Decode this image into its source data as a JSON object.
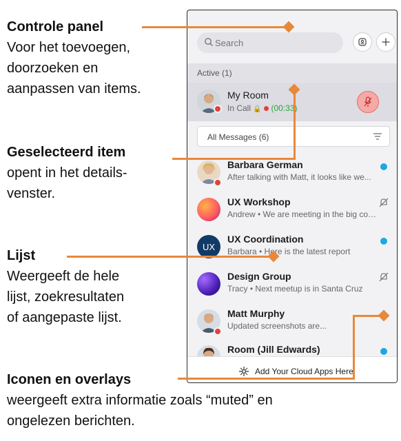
{
  "annotations": {
    "control_panel": {
      "title": "Controle panel",
      "lines": [
        "Voor het toevoegen,",
        "doorzoeken en",
        "aanpassen van items."
      ]
    },
    "selected_item": {
      "title": "Geselecteerd item",
      "lines": [
        "opent in het details-",
        "venster."
      ]
    },
    "list": {
      "title": "Lijst",
      "lines": [
        "Weergeeft de hele",
        "lijst, zoekresultaten",
        "of aangepaste lijst."
      ]
    },
    "icons_overlays": {
      "title": "Iconen en overlays",
      "lines": [
        "weergeeft extra informatie zoals “muted” en",
        "ongelezen berichten."
      ]
    }
  },
  "accent_color": "#e8883a",
  "app": {
    "search": {
      "placeholder": "Search"
    },
    "active_header": "Active (1)",
    "active_item": {
      "name": "My Room",
      "status": "In Call",
      "timer": "(00:33)"
    },
    "filter": {
      "label": "All Messages (6)"
    },
    "items": [
      {
        "title": "Barbara German",
        "message": "After talking with Matt, it looks like we...",
        "unread": true,
        "muted": false
      },
      {
        "title": "UX Workshop",
        "message": "Andrew • We are meeting in the big conf...",
        "unread": false,
        "muted": true
      },
      {
        "title": "UX Coordination",
        "message": "Barbara • Here is the latest report",
        "unread": true,
        "muted": false
      },
      {
        "title": "Design Group",
        "message": "Tracy • Next meetup is in Santa Cruz",
        "unread": false,
        "muted": true
      },
      {
        "title": "Matt Murphy",
        "message": "Updated screenshots are...",
        "unread": true,
        "muted": false
      },
      {
        "title": "Room (Jill Edwards)",
        "message": "",
        "unread": true,
        "muted": false
      }
    ],
    "ux_avatar_text": "UX",
    "bottom_bar": "Add Your Cloud Apps Here",
    "colors": {
      "unread": "#1ba8e3",
      "in_call_dot": "#e0423a",
      "timer": "#2da13a"
    }
  }
}
